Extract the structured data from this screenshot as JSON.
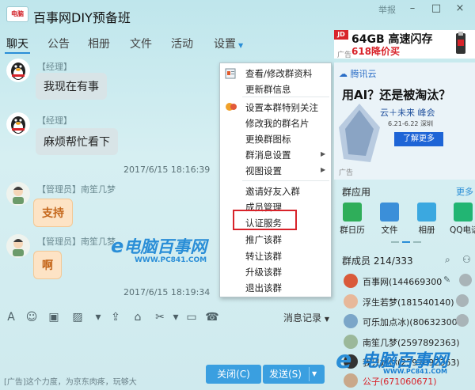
{
  "window": {
    "logo_text": "电脑",
    "title": "百事网DIY预备班",
    "report": "举报",
    "minimize": "–",
    "maximize": "□",
    "close": "×"
  },
  "tabs": [
    "聊天",
    "公告",
    "相册",
    "文件",
    "活动",
    "设置"
  ],
  "messages": [
    {
      "role": "【经理】",
      "name": "",
      "text": "我现在有事"
    },
    {
      "role": "【经理】",
      "name": "",
      "text": "麻烦帮忙看下"
    },
    {
      "timestamp": "2017/6/15 18:16:39"
    },
    {
      "role": "【管理员】",
      "name": "南笙几梦",
      "text": "支持"
    },
    {
      "role": "【管理员】",
      "name": "南笙几梦",
      "text": "啊"
    },
    {
      "timestamp": "2017/6/15 18:19:34"
    }
  ],
  "watermark": {
    "main": "电脑百事网",
    "sub": "WWW.PC841.COM",
    "bottom_main": "电脑百事网",
    "bottom_sub": "WWW.PC841.COM"
  },
  "context_menu": {
    "items": [
      "查看/修改群资料",
      "更新群信息",
      "设置本群特别关注",
      "修改我的群名片",
      "更换群图标",
      "群消息设置",
      "视图设置",
      "邀请好友入群",
      "成员管理",
      "认证服务",
      "推广该群",
      "转让该群",
      "升级该群",
      "退出该群"
    ]
  },
  "toolbar": {
    "icons": [
      "font-icon",
      "emoji-icon",
      "gif-icon",
      "image-icon",
      "upload-icon",
      "gift-icon",
      "scissors-icon",
      "phone-icon"
    ],
    "message_record": "消息记录"
  },
  "bottom": {
    "ad": "[广告]这个力度，为京东肉疼，玩够大",
    "close_label": "关闭(C)",
    "send_label": "发送(S)"
  },
  "right_panel": {
    "ad_top_line1": "64GB 高速闪存",
    "ad_top_line2": "618降价买",
    "ad_tag": "广告",
    "ad_main": {
      "logo": "腾讯云",
      "title": "用AI？还是被淘汰？",
      "sub": "云＋未来 峰会",
      "date": "6.21-6.22 深圳",
      "button": "了解更多"
    },
    "apps_header": "群应用",
    "apps_more": "更多",
    "apps": [
      {
        "label": "群日历",
        "color": "#2fae5a"
      },
      {
        "label": "文件",
        "color": "#3b8fd9"
      },
      {
        "label": "相册",
        "color": "#3ba8e0"
      },
      {
        "label": "QQ电话",
        "color": "#22b573"
      }
    ],
    "members_header": "群成员 214/333",
    "members": [
      "百事网(144669300",
      "浮生若梦(181540140)",
      "可乐加点冰)(80632300",
      "南笙几梦(2597892363)",
      "我只好你(2597892363)",
      "公子(671060671)"
    ]
  }
}
